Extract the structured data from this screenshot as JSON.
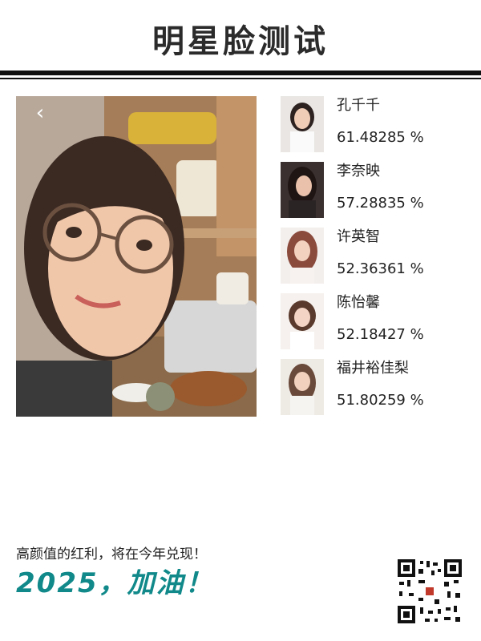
{
  "app": {
    "title": "明星脸测试"
  },
  "photo": {
    "back_icon": "chevron-left-icon",
    "back_glyph": "‹"
  },
  "matches": [
    {
      "name": "孔千千",
      "score": "61.48285 %"
    },
    {
      "name": "李奈映",
      "score": "57.28835 %"
    },
    {
      "name": "许英智",
      "score": "52.36361 %"
    },
    {
      "name": "陈怡馨",
      "score": "52.18427 %"
    },
    {
      "name": "福井裕佳梨",
      "score": "51.80259 %"
    }
  ],
  "footer": {
    "tagline": "高颜值的红利，将在今年兑现！",
    "slogan": "2025，加油！"
  },
  "colors": {
    "accent": "#11898a",
    "ink": "#111111"
  }
}
